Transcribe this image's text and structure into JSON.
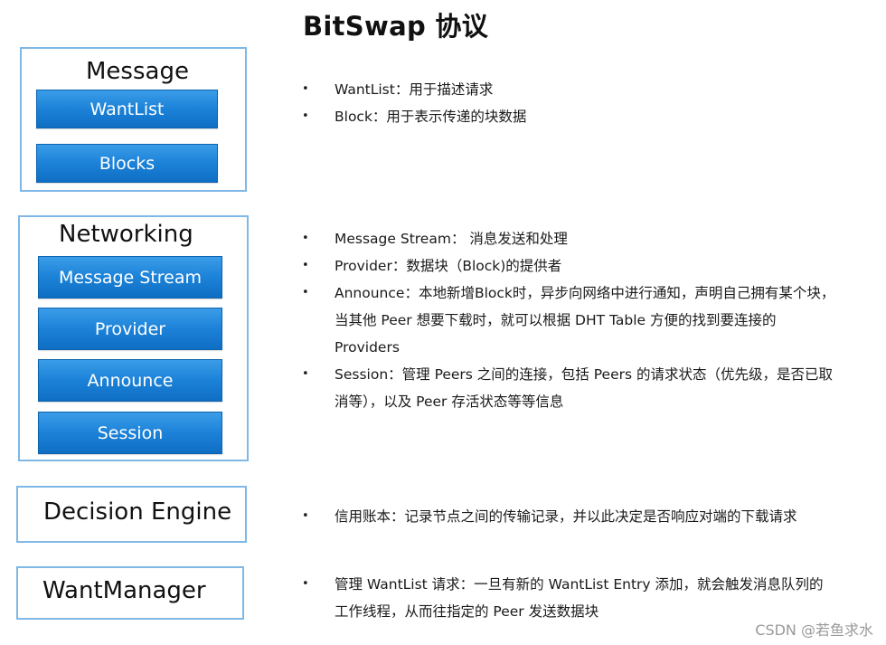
{
  "title": "BitSwap 协议",
  "sections": {
    "message": {
      "label": "Message",
      "blocks": [
        "WantList",
        "Blocks"
      ],
      "bullets": [
        "WantList：用于描述请求",
        "Block：用于表示传递的块数据"
      ]
    },
    "networking": {
      "label": "Networking",
      "blocks": [
        "Message Stream",
        "Provider",
        "Announce",
        "Session"
      ],
      "bullets": [
        "Message Stream： 消息发送和处理",
        "Provider：数据块（Block)的提供者",
        "Announce：本地新增Block时，异步向网络中进行通知，声明自己拥有某个块，当其他 Peer 想要下载时，就可以根据 DHT Table 方便的找到要连接的 Providers",
        "Session：管理 Peers 之间的连接，包括 Peers 的请求状态（优先级，是否已取消等），以及 Peer 存活状态等等信息"
      ]
    },
    "decision": {
      "label": "Decision Engine",
      "bullets": [
        "信用账本：记录节点之间的传输记录，并以此决定是否响应对端的下载请求"
      ]
    },
    "wantmanager": {
      "label": "WantManager",
      "bullets": [
        "管理 WantList 请求：一旦有新的 WantList Entry 添加，就会触发消息队列的工作线程，从而往指定的 Peer 发送数据块"
      ]
    }
  },
  "bullet_glyph": "•",
  "watermark": "CSDN @若鱼求水",
  "colors": {
    "frame_border": "#7fb8e6",
    "block_fill": "#1c82d8",
    "block_text": "#ffffff"
  }
}
